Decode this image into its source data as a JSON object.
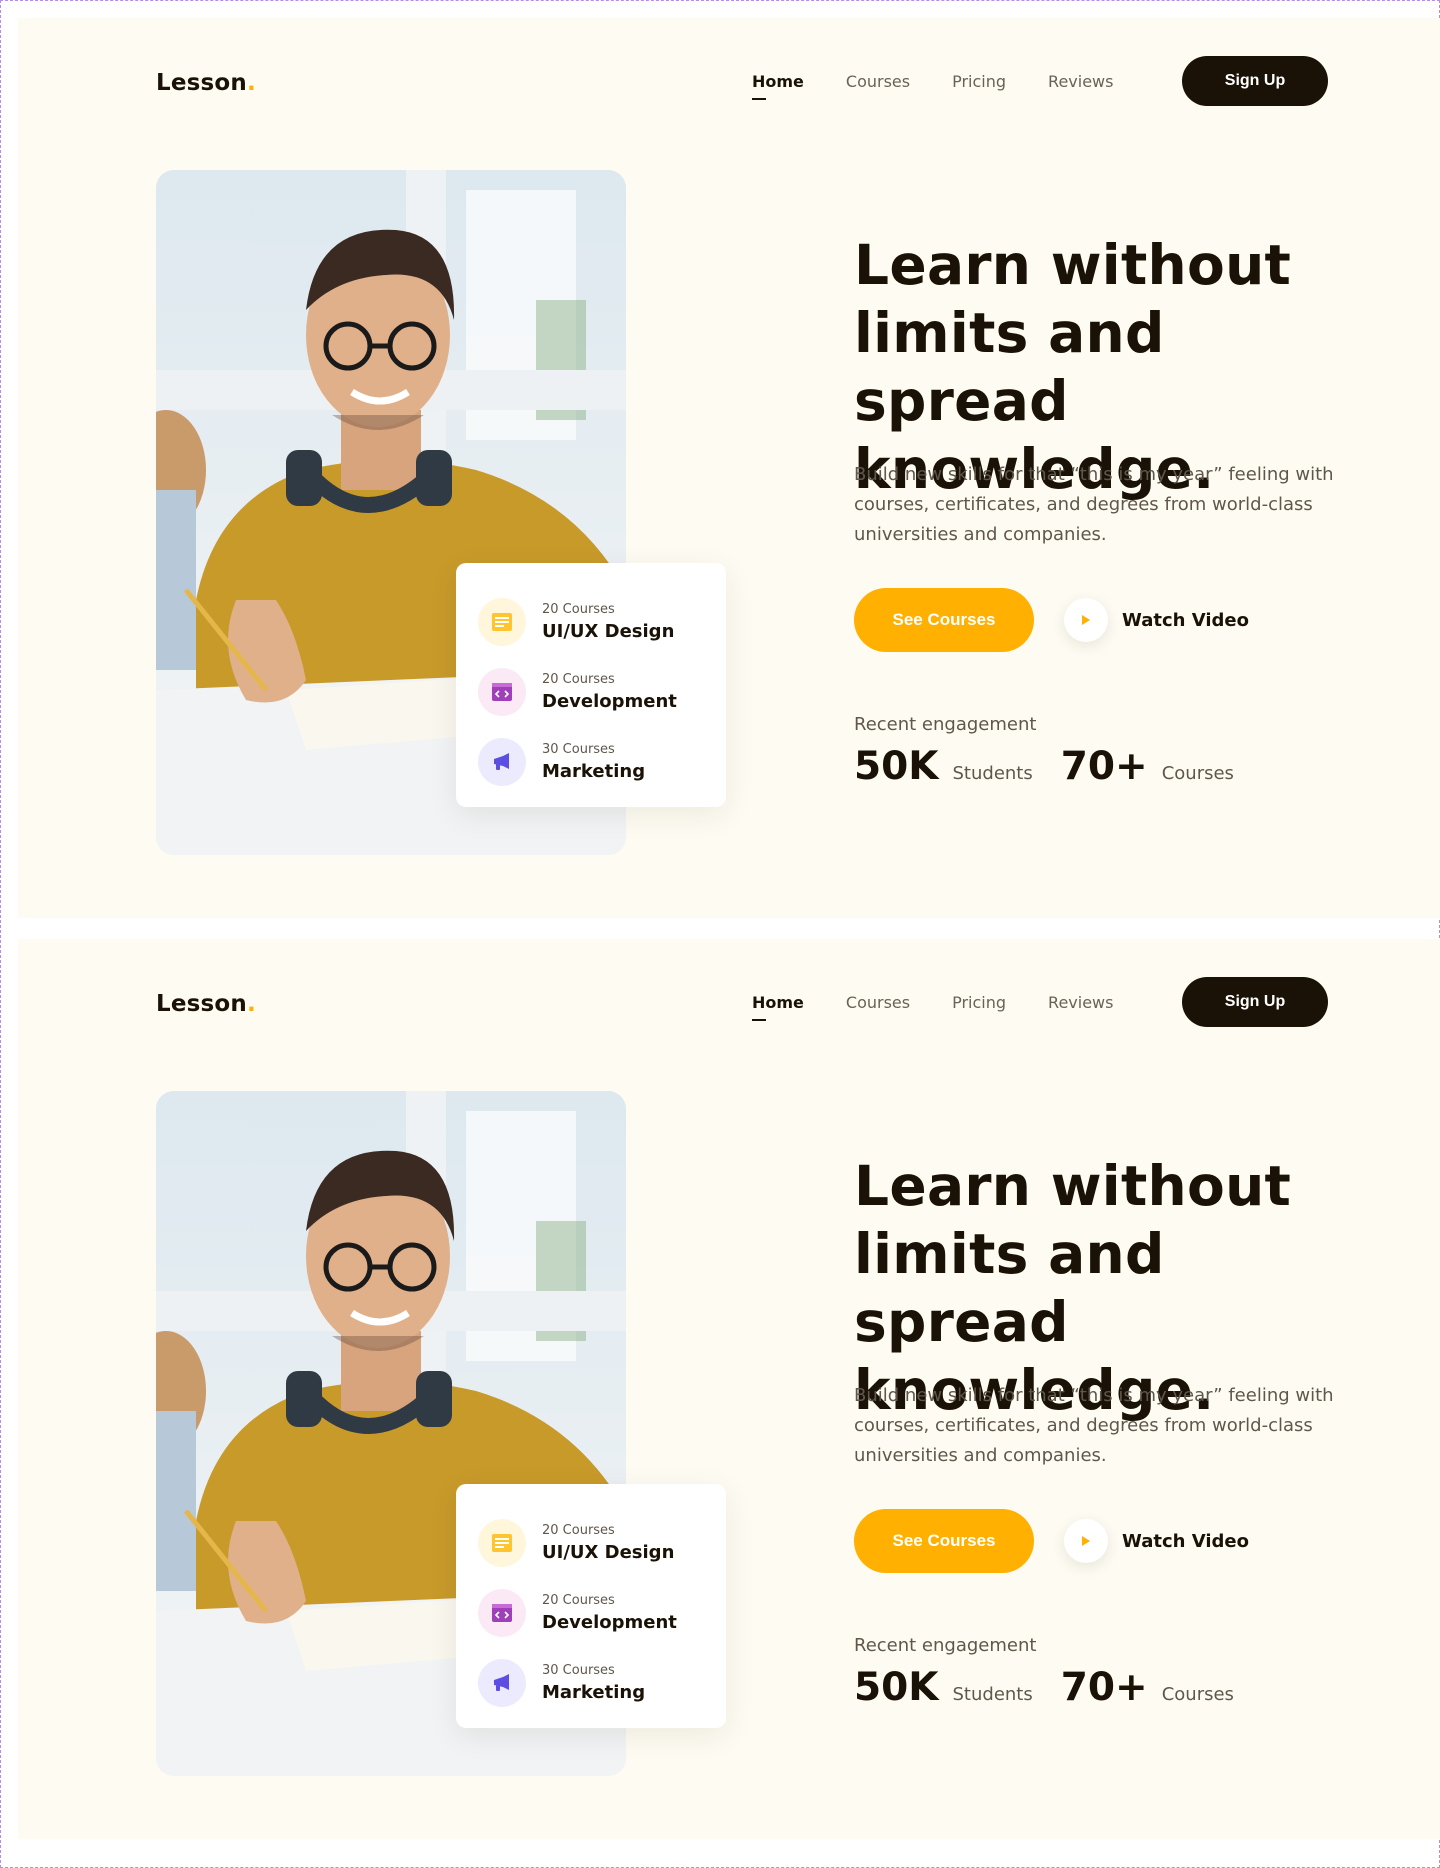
{
  "colors": {
    "accent": "#ffb000",
    "dark": "#1a1206",
    "background": "#fefcf2",
    "muted_text": "#5f574c"
  },
  "nav": {
    "logo": "Lesson",
    "logo_dot": ".",
    "links": [
      "Home",
      "Courses",
      "Pricing",
      "Reviews"
    ],
    "active_link": "Home",
    "signup_label": "Sign Up"
  },
  "courses": [
    {
      "count": "20 Courses",
      "name": "UI/UX Design",
      "icon": "document-icon"
    },
    {
      "count": "20 Courses",
      "name": "Development",
      "icon": "code-window-icon"
    },
    {
      "count": "30 Courses",
      "name": "Marketing",
      "icon": "megaphone-icon"
    }
  ],
  "hero": {
    "title_lines": [
      "Learn without",
      "limits and spread",
      "knowledge."
    ],
    "description_lines": [
      "Build new skills for that “this is my year” feeling with",
      "courses, certificates, and degrees from world-class",
      "universities and companies."
    ],
    "primary_cta": "See Courses",
    "secondary_cta": "Watch Video"
  },
  "engagement": {
    "label": "Recent engagement",
    "stats": [
      {
        "value": "50K",
        "unit": "Students"
      },
      {
        "value": "70+",
        "unit": "Courses"
      }
    ]
  }
}
